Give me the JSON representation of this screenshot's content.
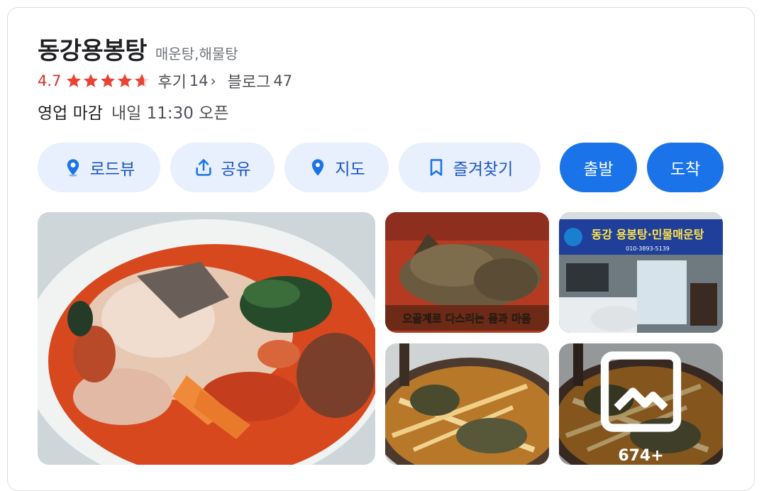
{
  "place": {
    "name": "동강용봉탕",
    "category": "매운탕,해물탕"
  },
  "rating": {
    "value": "4.7",
    "stars": 4.7,
    "reviews_label": "후기",
    "reviews_count": "14",
    "blog_label": "블로그",
    "blog_count": "47"
  },
  "hours": {
    "status": "영업 마감",
    "next_open": "내일 11:30 오픈"
  },
  "actions": {
    "roadview": "로드뷰",
    "share": "공유",
    "map": "지도",
    "save": "즐겨찾기",
    "depart": "출발",
    "arrive": "도착"
  },
  "photos": {
    "storefront_sign": "동강 용봉탕·민물매운탕",
    "storefront_phone": "010-3893-5139",
    "caption": "오골계로 다스리는 몸과 마음",
    "more_count": "674+"
  },
  "colors": {
    "accent": "#1a73e8",
    "accent_light": "#e8effd",
    "rating": "#d93025",
    "star": "#ea4335"
  }
}
